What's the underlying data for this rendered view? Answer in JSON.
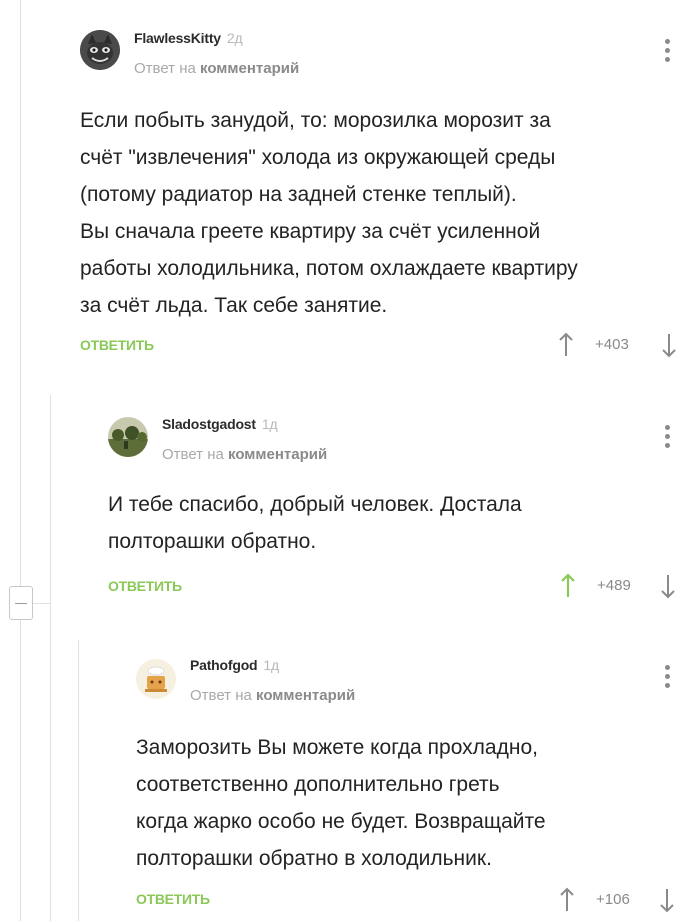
{
  "comments": [
    {
      "author": "FlawlessKitty",
      "age": "2д",
      "reply_prefix": "Ответ на",
      "reply_target": "комментарий",
      "text": "Если побыть занудой, то: морозилка морозит за\nсчёт \"извлечения\" холода из окружающей среды\n(потому радиатор на задней стенке теплый).\nВы сначала греете квартиру за счёт усиленной\nработы холодильника, потом охлаждаете квартиру\nза счёт льда. Так себе занятие.",
      "reply_label": "ОТВЕТИТЬ",
      "rating": "+403",
      "upvoted": false
    },
    {
      "author": "Sladostgadost",
      "age": "1д",
      "reply_prefix": "Ответ на",
      "reply_target": "комментарий",
      "text": "И тебе спасибо, добрый человек. Достала\nполторашки обратно.",
      "reply_label": "ОТВЕТИТЬ",
      "rating": "+489",
      "upvoted": true
    },
    {
      "author": "Pathofgod",
      "age": "1д",
      "reply_prefix": "Ответ на",
      "reply_target": "комментарий",
      "text": "Заморозить Вы можете когда прохладно,\nсоответственно дополнительно греть\nкогда жарко особо не будет. Возвращайте\nполторашки обратно в холодильник.",
      "reply_label": "ОТВЕТИТЬ",
      "rating": "+106",
      "upvoted": false
    }
  ],
  "colors": {
    "accent_green": "#8ac858",
    "muted_gray": "#8a8a8a",
    "thread_line": "#e0e0e0"
  },
  "icons": [
    "cat-avatar",
    "landscape-avatar",
    "cartoon-avatar",
    "kebab-menu-icon",
    "arrow-up-icon",
    "arrow-down-icon",
    "collapse-icon"
  ]
}
